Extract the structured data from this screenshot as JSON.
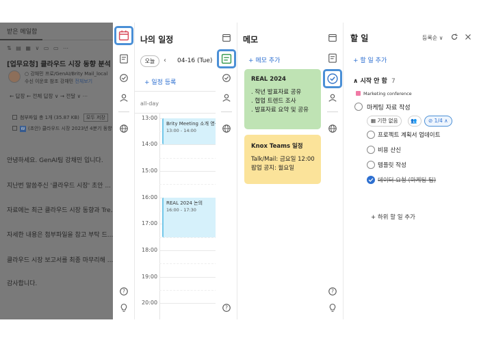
{
  "email": {
    "tab": "받은 메일함",
    "toolbar": "⇅ ▤ ▦ ∨ ▭ ▭ ⋯",
    "subject": "[업무요청] 클라우드 시장 동향 분석",
    "meta1": "○ 강채민 프로/GenAI/Brity Mail_local",
    "meta2_prefix": "수신 이운호  참조 강채민 ",
    "meta2_link": "전체보기",
    "actions": "← 답장  ← 전체 답장 ∨  → 전달 ∨  ⋯",
    "attach_summary": "첨부파일 총 1개 (35.87 KB)",
    "attach_button": "모두 저장",
    "attach_file": "(초안) 클라우드 시장 2023년 4분기 동향",
    "body_lines": [
      "안녕하세요. GenAI팀 강채민 입니다.",
      "지난번 말씀주신 '클라우드 시장' 초안 ...",
      "자료에는 최근 클라우드 시장 동향과 Tre...",
      "자세한 내용은 첨부파일을 참고 부탁 드...",
      "클라우드 시장 보고서를 최종 마무리해 ...",
      "감사합니다."
    ]
  },
  "calendar": {
    "title": "나의 일정",
    "today_button": "오늘",
    "prev": "‹",
    "date": "04-16 (Tue)",
    "add": "+ 일정 등록",
    "allday": "all-day",
    "times": [
      "13:00",
      "14:00",
      "15:00",
      "16:00",
      "17:00",
      "18:00",
      "19:00",
      "20:00"
    ],
    "events": [
      {
        "name": "Brity Meeting 소개 영상",
        "time": "13:00 - 14:00"
      },
      {
        "name": "REAL 2024 논의",
        "time": "16:00 - 17:30"
      }
    ]
  },
  "memo": {
    "title": "메모",
    "add": "+ 메모 추가",
    "cards": [
      {
        "title": "REAL 2024",
        "lines": [
          ". 작년 발표자료 공유",
          ". 협업 트렌드 조사",
          ". 발표자료 요약 및 공유"
        ],
        "color": "#bfe3b4"
      },
      {
        "title": "Knox Teams 일정",
        "lines": [
          "Talk/Mail: 금요일 12:00",
          "팝업 공지: 월요일"
        ],
        "color": "#fbe39a"
      }
    ]
  },
  "todo": {
    "title": "할 일",
    "sort": "등록순 ∨",
    "add": "+ 할 일 추가",
    "section": "시작 안 함",
    "section_toggle": "∧",
    "section_count": "7",
    "tag": "Marketing conference",
    "main_task": "마케팅 자료 작성",
    "pill_deadline": "기한 없음",
    "pill_progress": "1/4 ∧",
    "subtasks": [
      {
        "label": "프로젝트 계획서 업데이트",
        "done": false
      },
      {
        "label": "비용 산신",
        "done": false
      },
      {
        "label": "템플릿 작성",
        "done": false
      },
      {
        "label": "데이터 요청 (마케팅 팀)",
        "done": true
      }
    ],
    "add_subtask": "+ 하위 할 일 추가"
  },
  "colors": {
    "accent": "#2d6fd0",
    "rail_selected": "#4a8fd6",
    "event_bg": "#d6f1fb",
    "memo_green": "#bfe3b4",
    "memo_yellow": "#fbe39a",
    "tag_pink": "#f07aa5"
  }
}
